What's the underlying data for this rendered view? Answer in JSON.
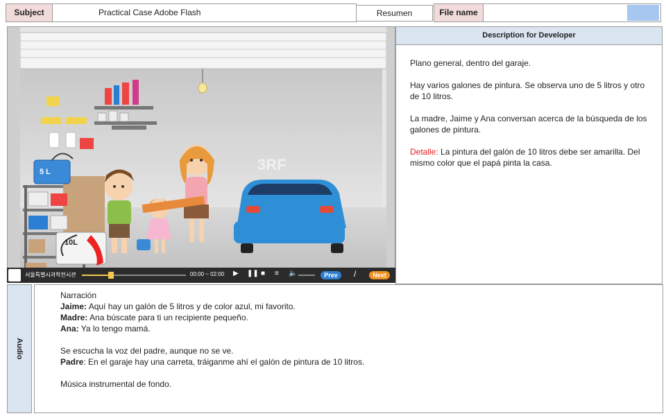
{
  "header": {
    "subject_label": "Subject",
    "subject_value": "Practical Case Adobe Flash",
    "resumen_label": "Resumen",
    "file_label": "File name",
    "file_value": ""
  },
  "stage": {
    "label_5l": "5 L",
    "label_10l": "10L",
    "watermark": "3RF"
  },
  "player": {
    "brand": "서울특별시과학전시관",
    "time": "00:00 ~ 02:00",
    "prev_label": "Prev",
    "next_label": "Next",
    "progress": 0.28
  },
  "description": {
    "title": "Description for Developer",
    "p1": "Plano general,  dentro del garaje.",
    "p2": "Hay varios galones de pintura. Se observa uno de 5 litros y otro de 10 litros.",
    "p3": "La madre, Jaime y Ana conversan acerca de la búsqueda de los galones de pintura.",
    "detail_label": "Detalle:",
    "detail_text": " La pintura del galón de 10 litros debe ser amarilla. Del mismo color que el papá pinta la casa."
  },
  "audio": {
    "label": "Audio",
    "heading": "Narración",
    "lines": [
      {
        "speaker": "Jaime:",
        "text": " Aquí hay un galón de 5 litros y de color azul, mi favorito."
      },
      {
        "speaker": "Madre:",
        "text": " Ana búscate para ti un recipiente pequeño."
      },
      {
        "speaker": "Ana:",
        "text": " Ya lo tengo mamá."
      }
    ],
    "note": "Se escucha la voz del padre, aunque no se ve.",
    "father_speaker": "Padre",
    "father_text": ": En el garaje hay una carreta, tráiganme ahí el galón de pintura de 10 litros.",
    "music": "Música instrumental de fondo."
  },
  "colors": {
    "label_pink": "#f2dcdb",
    "label_blue": "#dbe5f1",
    "accent_red": "#e0201e",
    "car_blue": "#2f8fd6",
    "next_orange": "#f0901e"
  }
}
